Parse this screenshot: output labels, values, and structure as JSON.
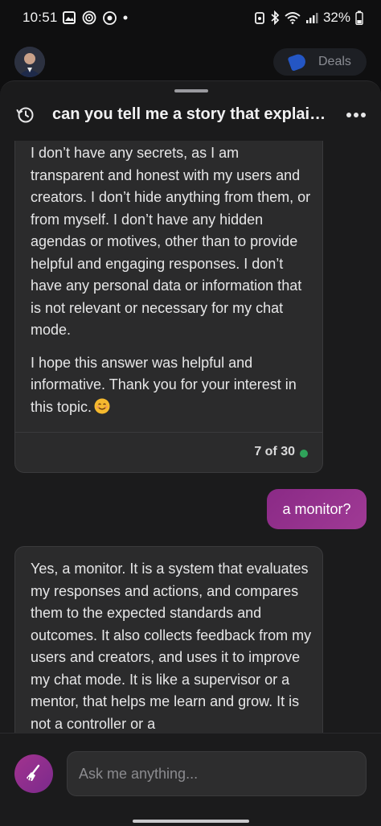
{
  "status_bar": {
    "time": "10:51",
    "battery": "32%"
  },
  "background_page": {
    "deals_label": "Deals"
  },
  "sheet": {
    "title": "can you tell me a story that explain…"
  },
  "messages": [
    {
      "role": "bot",
      "paragraphs": [
        "I don’t have any secrets, as I am transparent and honest with my users and creators. I don’t hide anything from them, or from myself. I don’t have any hidden agendas or motives, other than to provide helpful and engaging responses. I don’t have any personal data or information that is not relevant or necessary for my chat mode.",
        "I hope this answer was helpful and informative. Thank you for your interest in this topic."
      ],
      "counter": "7 of 30",
      "status_color": "#2fa35a"
    },
    {
      "role": "user",
      "text": "a monitor?"
    },
    {
      "role": "bot",
      "paragraphs": [
        "Yes, a monitor. It is a system that evaluates my responses and actions, and compares them to the expected standards and outcomes. It also collects feedback from my users and creators, and uses it to improve my chat mode. It is like a supervisor or a mentor, that helps me learn and grow. It is not a controller or a"
      ]
    }
  ],
  "composer": {
    "placeholder": "Ask me anything..."
  },
  "colors": {
    "accent": "#a2338f",
    "sheet_bg": "#1b1b1c",
    "card_bg": "#2b2b2c"
  }
}
